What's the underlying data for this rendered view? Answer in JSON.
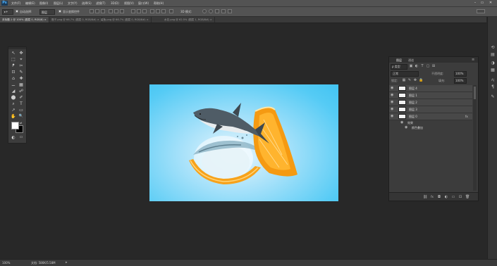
{
  "app": {
    "logo": "Ps"
  },
  "menu": [
    "文件(F)",
    "编辑(E)",
    "图像(I)",
    "图层(L)",
    "文字(Y)",
    "选择(S)",
    "滤镜(T)",
    "3D(D)",
    "视图(V)",
    "窗口(W)",
    "帮助(H)"
  ],
  "window_controls": {
    "minimize": "–",
    "maximize": "▭",
    "close": "✕"
  },
  "options": {
    "auto_select_label": "自动选择:",
    "auto_select_value": "图层",
    "show_transform_label": "显示变换控件",
    "mode_3d_label": "3D 模式:"
  },
  "tabs": [
    {
      "label": "未标题-1 @ 100% (图层 0, RGB/8) × ",
      "active": true
    },
    {
      "label": "橙子.png @ 66.7% (图层 0, RGB/8#) ×",
      "active": false
    },
    {
      "label": "鲨鱼.png @ 66.7% (图层 0, RGB/8#) ×",
      "active": false
    },
    {
      "label": "水花.png @ 62.5% (图层 1, RGB/8#) ×",
      "active": false
    }
  ],
  "tools": [
    "↖",
    "✥",
    "⬚",
    "⌖",
    "ᖰ",
    "✂",
    "⊡",
    "✎",
    "⌂",
    "✚",
    "⚊",
    "▦",
    "◢",
    "☍",
    "⬤",
    "✐",
    "⌕",
    "T",
    "↗",
    "▭",
    "✋",
    "🔍",
    "◐",
    "⇄"
  ],
  "colors": {
    "foreground": "#ffffff",
    "background": "#000000",
    "accent": "#42c3f2"
  },
  "layers_panel": {
    "tabs": [
      "图层",
      "通道"
    ],
    "kind_filter": "ρ 类型",
    "blend_mode": "正常",
    "opacity_label": "不透明度:",
    "opacity_value": "100%",
    "lock_label": "锁定:",
    "fill_label": "填充:",
    "fill_value": "100%",
    "layers": [
      {
        "name": "图层 4"
      },
      {
        "name": "图层 1"
      },
      {
        "name": "图层 2"
      },
      {
        "name": "图层 3"
      },
      {
        "name": "图层 0",
        "fx": "fx"
      }
    ],
    "effects_label": "效果",
    "effect_item": "颜色叠加",
    "bottom_icons": [
      "link-icon",
      "fx-icon",
      "mask-icon",
      "adjustment-icon",
      "group-icon",
      "new-layer-icon",
      "trash-icon"
    ]
  },
  "status": {
    "zoom": "100%",
    "doc_info": "文档: 586K/5.58M"
  }
}
